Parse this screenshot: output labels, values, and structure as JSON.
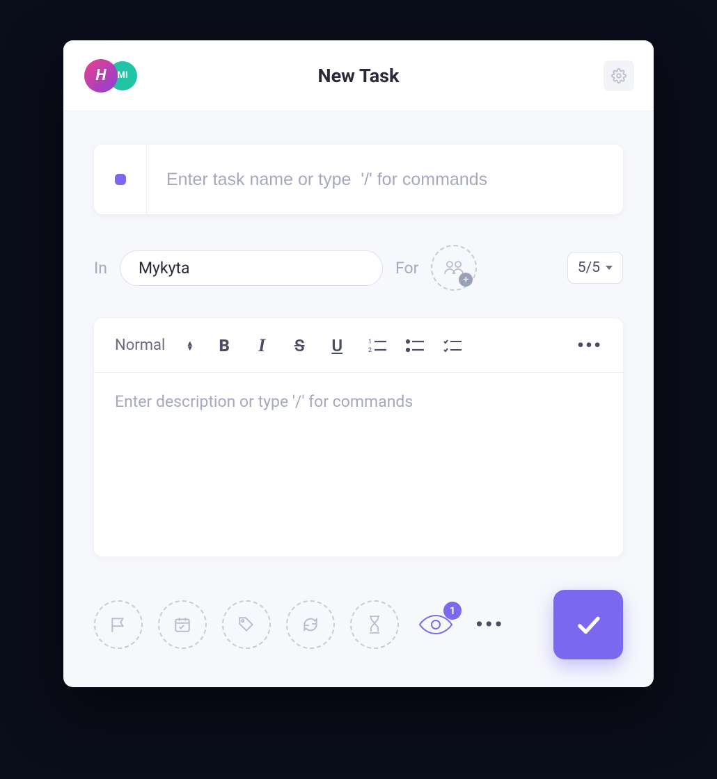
{
  "header": {
    "title": "New Task",
    "avatar1_initial": "H",
    "avatar2_initial": "MI"
  },
  "task": {
    "name_placeholder": "Enter task name or type  '/' for commands",
    "in_label": "In",
    "in_value": "Mykyta",
    "for_label": "For",
    "count_label": "5/5"
  },
  "editor": {
    "style_label": "Normal",
    "desc_placeholder": "Enter description or type '/' for commands"
  },
  "footer": {
    "watch_count": "1"
  }
}
